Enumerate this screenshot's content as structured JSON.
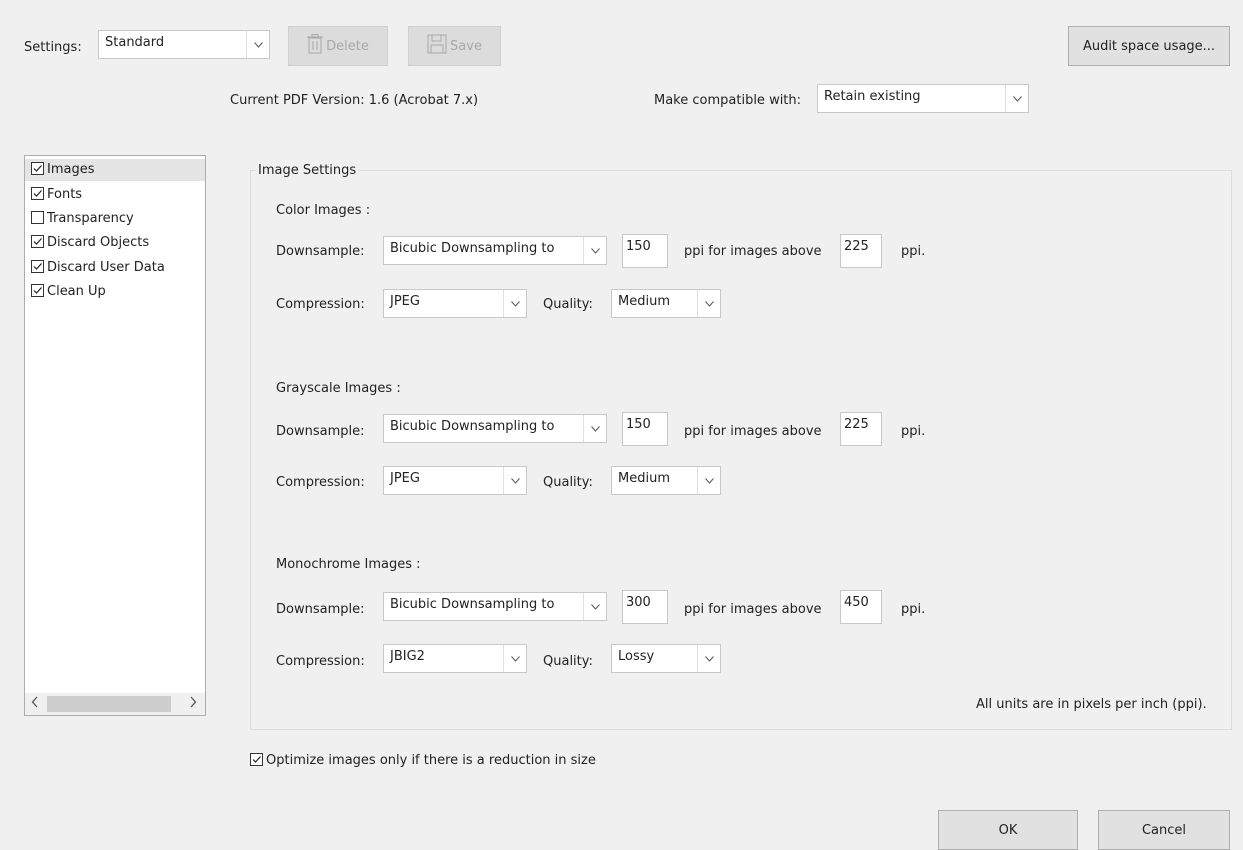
{
  "header": {
    "settings_label": "Settings:",
    "settings_value": "Standard",
    "delete_label": "Delete",
    "save_label": "Save",
    "audit_label": "Audit space usage...",
    "pdf_version": "Current PDF Version: 1.6 (Acrobat 7.x)",
    "compat_label": "Make compatible with:",
    "compat_value": "Retain existing"
  },
  "panel": {
    "items": [
      {
        "label": "Images",
        "checked": true
      },
      {
        "label": "Fonts",
        "checked": true
      },
      {
        "label": "Transparency",
        "checked": false
      },
      {
        "label": "Discard Objects",
        "checked": true
      },
      {
        "label": "Discard User Data",
        "checked": true
      },
      {
        "label": "Clean Up",
        "checked": true
      }
    ]
  },
  "image_settings": {
    "title": "Image Settings",
    "downsample_label": "Downsample:",
    "compression_label": "Compression:",
    "quality_label": "Quality:",
    "ppi_above_label": "ppi for images above",
    "ppi_label": "ppi.",
    "groups": [
      {
        "title": "Color Images :",
        "downsample": "Bicubic Downsampling to",
        "ppi": "150",
        "above": "225",
        "compression": "JPEG",
        "quality": "Medium"
      },
      {
        "title": "Grayscale Images :",
        "downsample": "Bicubic Downsampling to",
        "ppi": "150",
        "above": "225",
        "compression": "JPEG",
        "quality": "Medium"
      },
      {
        "title": "Monochrome Images :",
        "downsample": "Bicubic Downsampling to",
        "ppi": "300",
        "above": "450",
        "compression": "JBIG2",
        "quality": "Lossy"
      }
    ],
    "units_note": "All units are in pixels per inch (ppi)."
  },
  "optimize_label": "Optimize images only if there is a reduction in size",
  "ok_label": "OK",
  "cancel_label": "Cancel"
}
